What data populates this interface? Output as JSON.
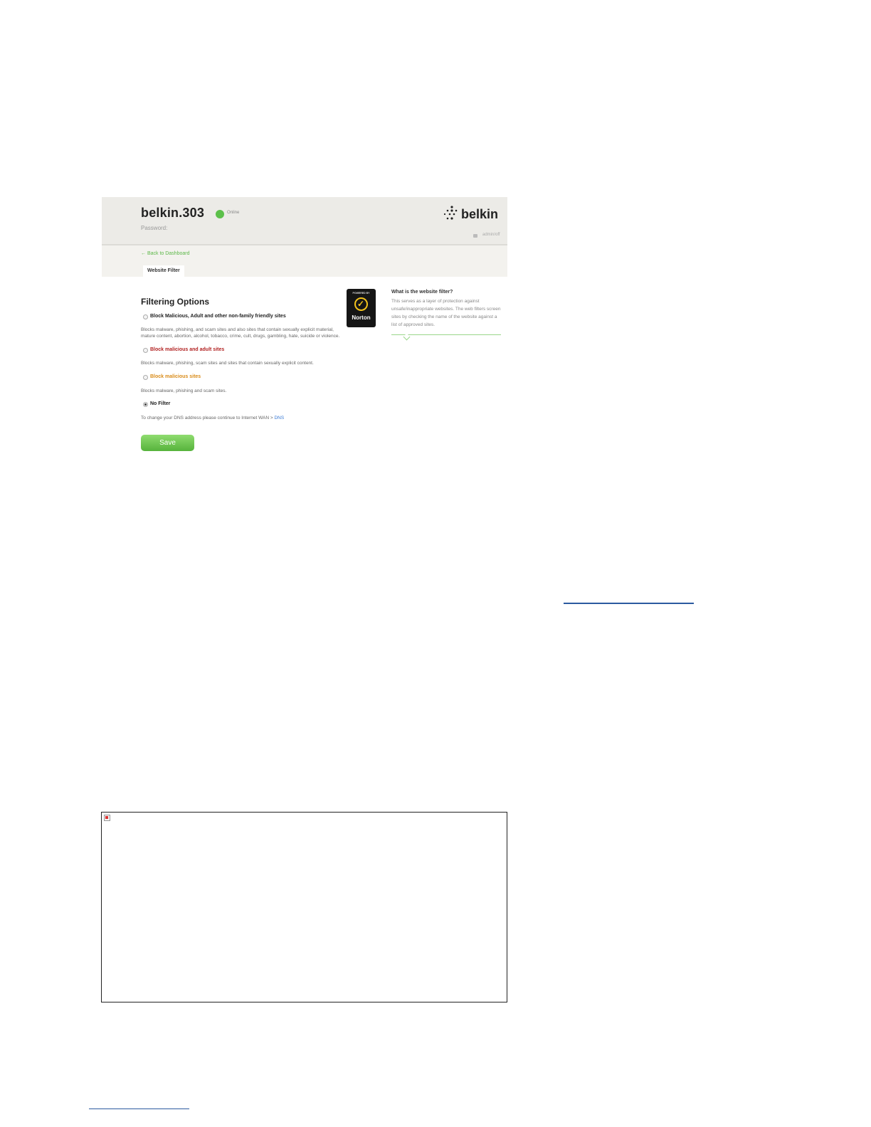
{
  "router": {
    "name": "belkin.303",
    "status": "Online",
    "password_label": "Password:",
    "brand": "belkin",
    "user_label": "admin/off",
    "status_color": "#5cc04a"
  },
  "nav": {
    "back_link": "← Back to Dashboard",
    "tab_label": "Website Filter"
  },
  "filter": {
    "title": "Filtering Options",
    "options": [
      {
        "label": "Block Malicious, Adult and other non-family friendly sites",
        "color": "#222222",
        "checked": false,
        "description_lines": [
          "Blocks malware, phishing, and scam sites and also sites that contain sexually explicit material,",
          "mature content, abortion, alcohol, tobacco, crime, cult, drugs, gambling, hate, suicide or violence."
        ]
      },
      {
        "label": "Block malicious and adult sites",
        "color": "#b22222",
        "checked": false,
        "description_lines": [
          "Blocks malware, phishing, scam sites and sites that contain sexually explicit content."
        ]
      },
      {
        "label": "Block malicious sites",
        "color": "#d98c1a",
        "checked": false,
        "description_lines": [
          "Blocks malware, phishing and scam sites."
        ]
      },
      {
        "label": "No Filter",
        "color": "#222222",
        "checked": true,
        "description_lines": []
      }
    ],
    "dns_note": "To change your DNS address please continue to Internet WAN > ",
    "dns_link": "DNS",
    "save_label": "Save"
  },
  "norton": {
    "top_text": "POWERED BY",
    "name": "Norton"
  },
  "help": {
    "title": "What is the website filter?",
    "text": "This serves as a layer of protection against unsafe/inappropriate websites. The web filters screen sites by checking the name of the website against a list of approved sites."
  },
  "colors": {
    "accent_green": "#5cb848",
    "link_blue": "#3a7bd5"
  }
}
